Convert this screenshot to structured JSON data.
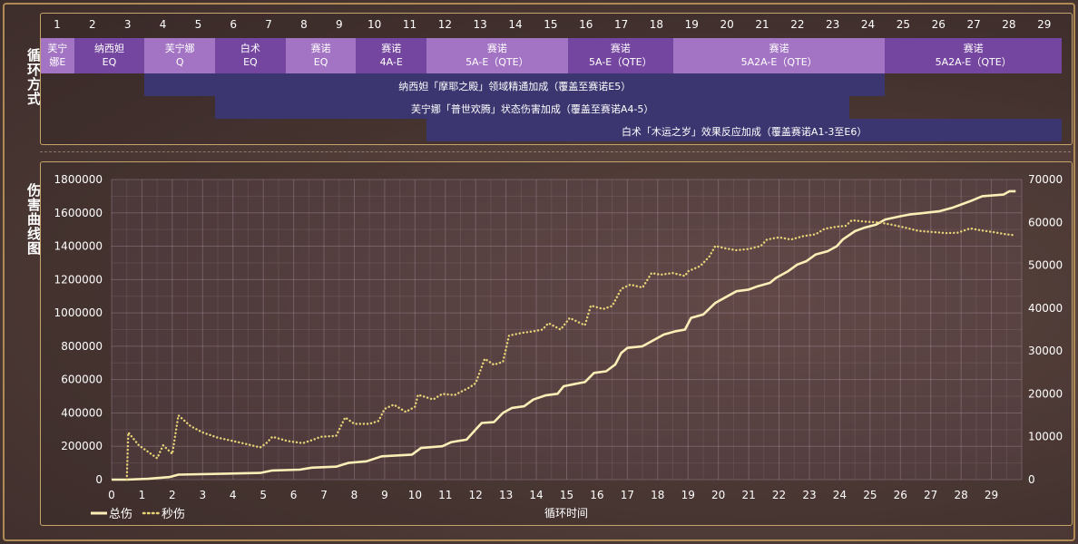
{
  "section_labels": {
    "top": "循环方式",
    "bottom": "伤害曲线图"
  },
  "cycle_numbers": [
    "1",
    "2",
    "3",
    "4",
    "5",
    "6",
    "7",
    "8",
    "9",
    "10",
    "11",
    "12",
    "13",
    "14",
    "15",
    "16",
    "17",
    "18",
    "19",
    "20",
    "21",
    "22",
    "23",
    "24",
    "25",
    "26",
    "27",
    "28",
    "29"
  ],
  "rotation": [
    {
      "line1": "芙宁",
      "line2": "娜E",
      "start": 0.48,
      "end": 1.48
    },
    {
      "line1": "纳西妲",
      "line2": "EQ",
      "start": 1.48,
      "end": 3.48
    },
    {
      "line1": "芙宁娜",
      "line2": "Q",
      "start": 3.48,
      "end": 5.48
    },
    {
      "line1": "白术",
      "line2": "EQ",
      "start": 5.48,
      "end": 7.48
    },
    {
      "line1": "赛诺",
      "line2": "EQ",
      "start": 7.48,
      "end": 9.48
    },
    {
      "line1": "赛诺",
      "line2": "4A-E",
      "start": 9.48,
      "end": 11.48
    },
    {
      "line1": "赛诺",
      "line2": "5A-E（QTE）",
      "start": 11.48,
      "end": 15.48
    },
    {
      "line1": "赛诺",
      "line2": "5A-E（QTE）",
      "start": 15.48,
      "end": 18.48
    },
    {
      "line1": "赛诺",
      "line2": "5A2A-E（QTE）",
      "start": 18.48,
      "end": 24.48
    },
    {
      "line1": "赛诺",
      "line2": "5A2A-E（QTE）",
      "start": 24.48,
      "end": 29.5
    }
  ],
  "buffs": [
    {
      "text": "纳西妲「摩耶之殿」领域精通加成（覆盖至赛诺E5）",
      "start": 3.48,
      "end": 24.48
    },
    {
      "text": "芙宁娜「普世欢腾」状态伤害加成（覆盖至赛诺A4-5）",
      "start": 5.48,
      "end": 23.48
    },
    {
      "text": "白术「木运之岁」效果反应加成（覆盖赛诺A1-3至E6）",
      "start": 11.48,
      "end": 29.5
    }
  ],
  "colors": {
    "rotation_dark": "#7546a0",
    "rotation_light": "#a373c4",
    "buff": "#3b3570",
    "total_line": "#fbeeb6",
    "dps_line": "#e8d477",
    "panel_border": "#c4a46a"
  },
  "chart_data": {
    "type": "line",
    "xlabel": "循环时间",
    "xlim": [
      0,
      30
    ],
    "x_ticks": [
      0,
      1,
      2,
      3,
      4,
      5,
      6,
      7,
      8,
      9,
      10,
      11,
      12,
      13,
      14,
      15,
      16,
      17,
      18,
      19,
      20,
      21,
      22,
      23,
      24,
      25,
      26,
      27,
      28,
      29
    ],
    "left_ylim": [
      0,
      1800000
    ],
    "left_ticks": [
      0,
      200000,
      400000,
      600000,
      800000,
      1000000,
      1200000,
      1400000,
      1600000,
      1800000
    ],
    "right_ylim": [
      0,
      70000
    ],
    "right_ticks": [
      0,
      10000,
      20000,
      30000,
      40000,
      50000,
      60000,
      70000
    ],
    "grid": true,
    "legend_position": "bottom-left",
    "series": [
      {
        "name": "总伤",
        "axis": "left",
        "style": "solid",
        "points": [
          [
            0,
            0
          ],
          [
            0.5,
            0
          ],
          [
            1.2,
            5000
          ],
          [
            1.9,
            15000
          ],
          [
            2.2,
            30000
          ],
          [
            4.9,
            40000
          ],
          [
            5.3,
            55000
          ],
          [
            6.2,
            60000
          ],
          [
            6.6,
            72000
          ],
          [
            7.4,
            78000
          ],
          [
            7.8,
            100000
          ],
          [
            8.4,
            110000
          ],
          [
            8.9,
            140000
          ],
          [
            9.9,
            150000
          ],
          [
            10.2,
            190000
          ],
          [
            10.9,
            200000
          ],
          [
            11.2,
            225000
          ],
          [
            11.7,
            240000
          ],
          [
            12.0,
            300000
          ],
          [
            12.2,
            340000
          ],
          [
            12.6,
            345000
          ],
          [
            12.9,
            400000
          ],
          [
            13.2,
            430000
          ],
          [
            13.6,
            440000
          ],
          [
            13.9,
            480000
          ],
          [
            14.3,
            505000
          ],
          [
            14.7,
            515000
          ],
          [
            14.9,
            560000
          ],
          [
            15.3,
            575000
          ],
          [
            15.6,
            585000
          ],
          [
            15.9,
            640000
          ],
          [
            16.3,
            650000
          ],
          [
            16.6,
            690000
          ],
          [
            16.8,
            760000
          ],
          [
            17.0,
            790000
          ],
          [
            17.5,
            800000
          ],
          [
            17.9,
            840000
          ],
          [
            18.2,
            870000
          ],
          [
            18.6,
            890000
          ],
          [
            18.9,
            900000
          ],
          [
            19.1,
            970000
          ],
          [
            19.5,
            990000
          ],
          [
            19.9,
            1060000
          ],
          [
            20.3,
            1100000
          ],
          [
            20.6,
            1130000
          ],
          [
            21.0,
            1140000
          ],
          [
            21.3,
            1160000
          ],
          [
            21.7,
            1180000
          ],
          [
            21.9,
            1210000
          ],
          [
            22.3,
            1250000
          ],
          [
            22.6,
            1290000
          ],
          [
            22.9,
            1310000
          ],
          [
            23.2,
            1350000
          ],
          [
            23.6,
            1370000
          ],
          [
            23.9,
            1400000
          ],
          [
            24.1,
            1440000
          ],
          [
            24.5,
            1490000
          ],
          [
            24.8,
            1510000
          ],
          [
            25.2,
            1530000
          ],
          [
            25.5,
            1560000
          ],
          [
            26.0,
            1580000
          ],
          [
            26.3,
            1590000
          ],
          [
            26.8,
            1600000
          ],
          [
            27.3,
            1610000
          ],
          [
            27.7,
            1630000
          ],
          [
            28.0,
            1650000
          ],
          [
            28.3,
            1670000
          ],
          [
            28.7,
            1700000
          ],
          [
            29.4,
            1710000
          ],
          [
            29.6,
            1730000
          ],
          [
            29.8,
            1730000
          ]
        ]
      },
      {
        "name": "秒伤",
        "axis": "right",
        "style": "dotted",
        "points": [
          [
            0.5,
            0
          ],
          [
            0.55,
            11000
          ],
          [
            0.9,
            8000
          ],
          [
            1.5,
            5000
          ],
          [
            1.7,
            8000
          ],
          [
            2.0,
            6000
          ],
          [
            2.2,
            15000
          ],
          [
            2.6,
            12500
          ],
          [
            3.0,
            11000
          ],
          [
            3.5,
            9800
          ],
          [
            4.0,
            9000
          ],
          [
            4.5,
            8200
          ],
          [
            4.9,
            7500
          ],
          [
            5.1,
            8500
          ],
          [
            5.3,
            10000
          ],
          [
            5.8,
            9000
          ],
          [
            6.3,
            8500
          ],
          [
            6.6,
            9200
          ],
          [
            6.9,
            10000
          ],
          [
            7.4,
            10200
          ],
          [
            7.7,
            14500
          ],
          [
            8.0,
            13000
          ],
          [
            8.5,
            13000
          ],
          [
            8.8,
            13700
          ],
          [
            9.0,
            16500
          ],
          [
            9.3,
            17500
          ],
          [
            9.7,
            15800
          ],
          [
            10.0,
            17000
          ],
          [
            10.1,
            19800
          ],
          [
            10.6,
            18700
          ],
          [
            10.9,
            20000
          ],
          [
            11.3,
            19700
          ],
          [
            11.8,
            21500
          ],
          [
            12.0,
            22500
          ],
          [
            12.3,
            28200
          ],
          [
            12.6,
            26800
          ],
          [
            12.9,
            27500
          ],
          [
            13.1,
            33600
          ],
          [
            13.5,
            34200
          ],
          [
            13.9,
            34600
          ],
          [
            14.2,
            35000
          ],
          [
            14.4,
            36500
          ],
          [
            14.8,
            35000
          ],
          [
            15.1,
            37700
          ],
          [
            15.6,
            36000
          ],
          [
            15.8,
            40600
          ],
          [
            16.2,
            39800
          ],
          [
            16.5,
            40500
          ],
          [
            16.8,
            44500
          ],
          [
            17.1,
            45500
          ],
          [
            17.5,
            44800
          ],
          [
            17.8,
            48200
          ],
          [
            18.1,
            47800
          ],
          [
            18.5,
            48200
          ],
          [
            18.9,
            47500
          ],
          [
            19.0,
            48600
          ],
          [
            19.4,
            49800
          ],
          [
            19.7,
            52000
          ],
          [
            19.9,
            54500
          ],
          [
            20.2,
            54000
          ],
          [
            20.6,
            53500
          ],
          [
            21.0,
            53800
          ],
          [
            21.4,
            54500
          ],
          [
            21.6,
            56000
          ],
          [
            22.0,
            56500
          ],
          [
            22.4,
            56000
          ],
          [
            22.8,
            56800
          ],
          [
            23.2,
            57200
          ],
          [
            23.5,
            58500
          ],
          [
            23.9,
            59000
          ],
          [
            24.2,
            59200
          ],
          [
            24.4,
            60500
          ],
          [
            24.8,
            60200
          ],
          [
            25.3,
            60000
          ],
          [
            25.7,
            59500
          ],
          [
            26.2,
            58700
          ],
          [
            26.6,
            58000
          ],
          [
            27.0,
            57800
          ],
          [
            27.5,
            57500
          ],
          [
            27.9,
            57600
          ],
          [
            28.3,
            58600
          ],
          [
            28.7,
            58100
          ],
          [
            29.1,
            57700
          ],
          [
            29.5,
            57200
          ],
          [
            29.8,
            57000
          ]
        ]
      }
    ]
  }
}
